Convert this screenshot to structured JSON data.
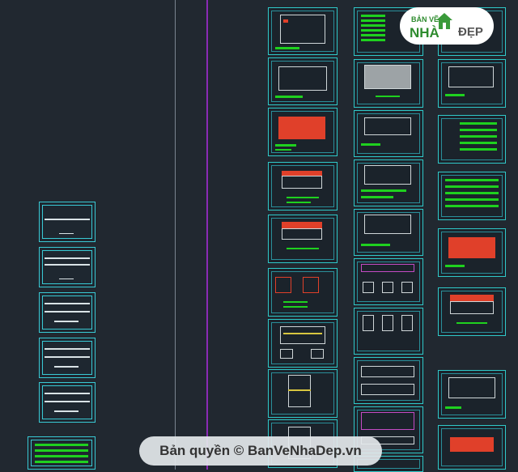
{
  "logo": {
    "small": "BẢN VẼ",
    "big": "NHÀ",
    "dep": "ĐẸP"
  },
  "watermark": {
    "text": "Bản quyền © BanVeNhaDep.vn"
  },
  "colors": {
    "background": "#212830",
    "frame": "#2fc9c9",
    "annotation": "#1fd11f",
    "roof": "#e0402a",
    "accent_line": "#8a2bb5"
  },
  "drawing_columns": [
    "left-cover-sheets",
    "architecture-sheets",
    "structure-sheets",
    "detail-sheets"
  ]
}
